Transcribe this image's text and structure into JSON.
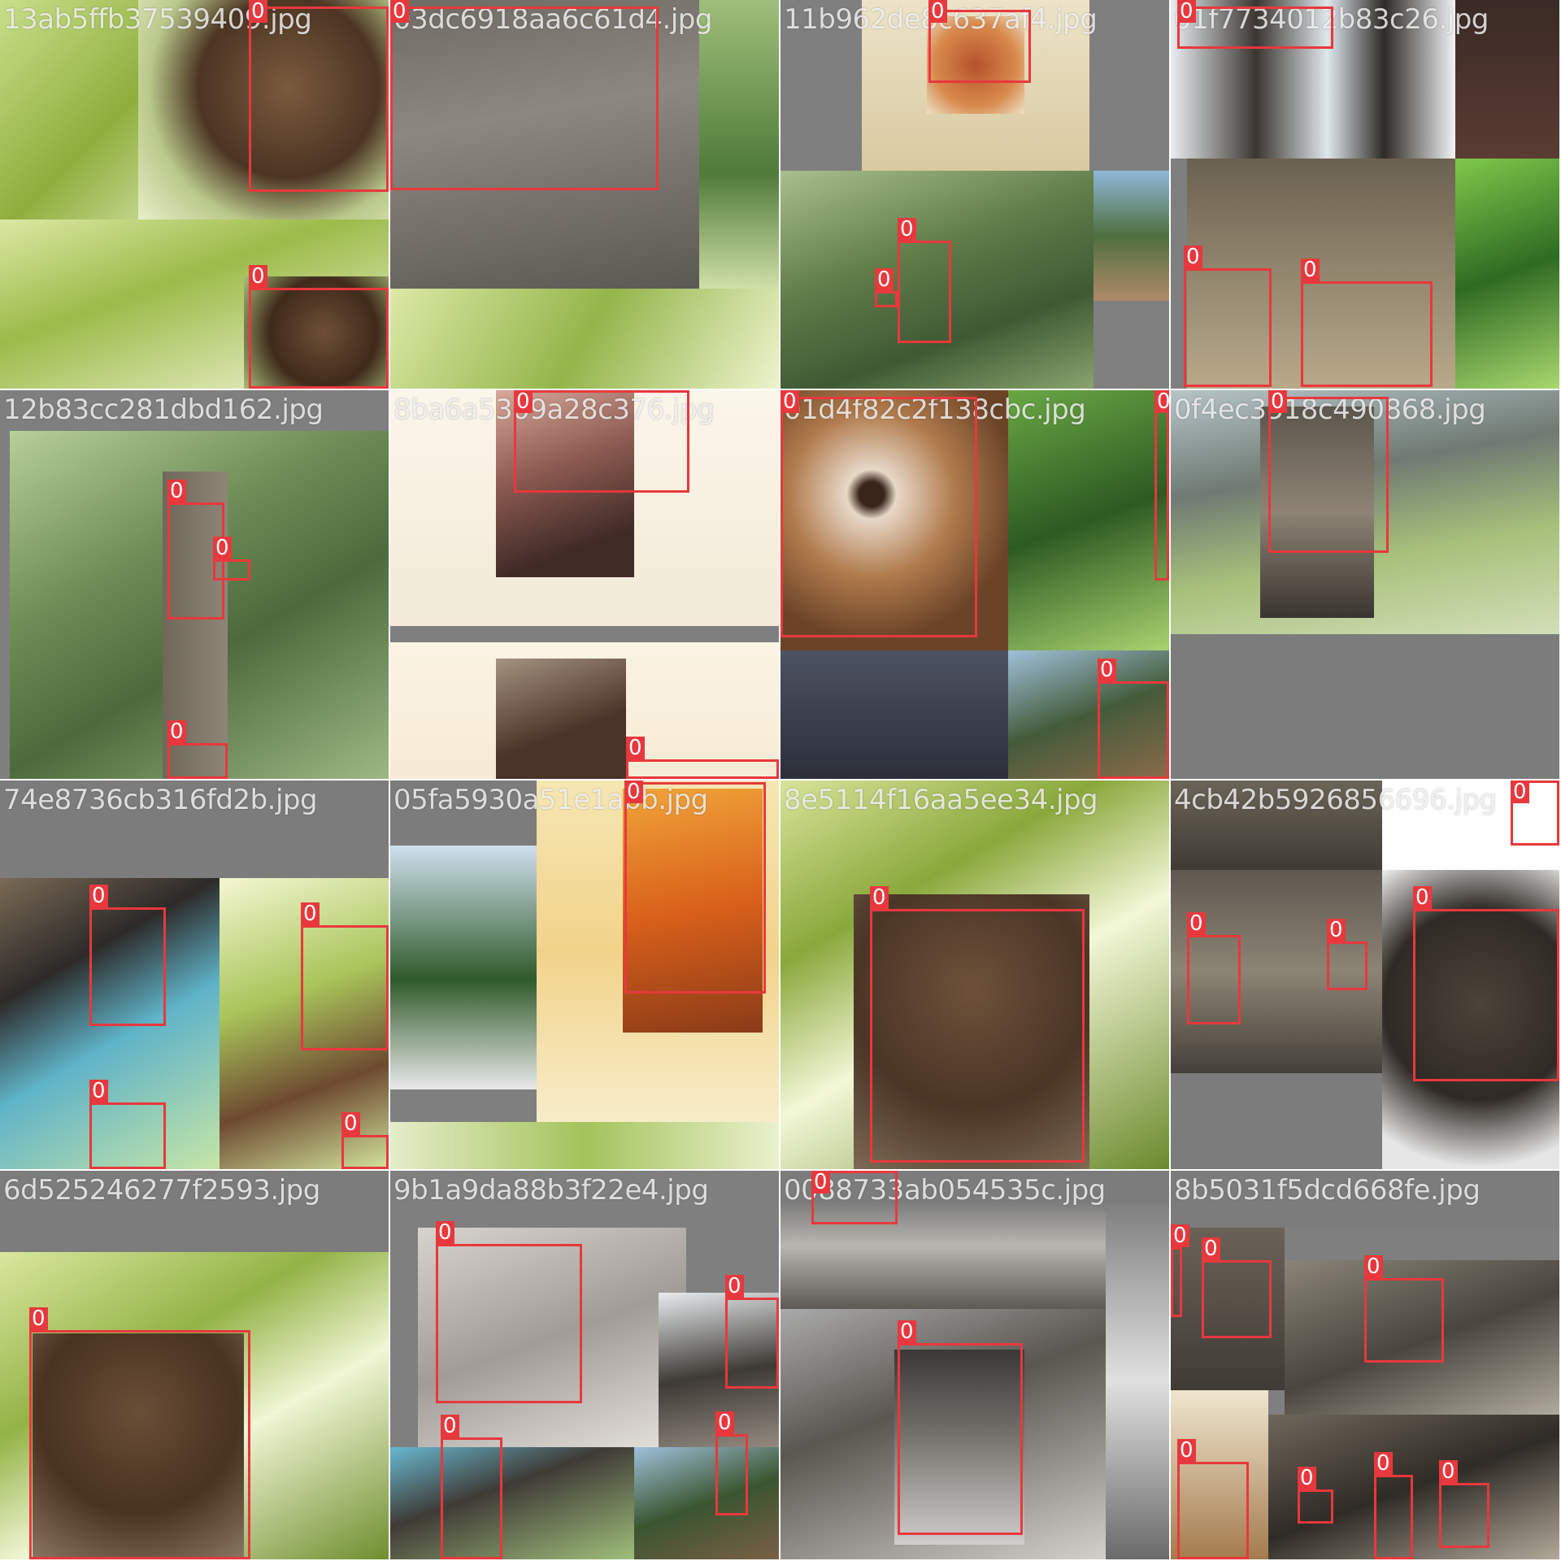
{
  "colors": {
    "box": "#e8383d",
    "label_text": "#ffffff",
    "filename_text": "#eeeeee",
    "pad": "#7f7f7f"
  },
  "box_label": "0",
  "tiles": [
    {
      "filename": "13ab5ffb37539409.jpg"
    },
    {
      "filename": "03dc6918aa6c61d4.jpg"
    },
    {
      "filename": "11b962de8c637af4.jpg"
    },
    {
      "filename": "01f7734012b83c26.jpg"
    },
    {
      "filename": "12b83cc281dbd162.jpg"
    },
    {
      "filename": "8ba6a5309a28c376.jpg"
    },
    {
      "filename": "01d4f82c2f138cbc.jpg"
    },
    {
      "filename": "0f4ec3518c490868.jpg"
    },
    {
      "filename": "74e8736cb316fd2b.jpg"
    },
    {
      "filename": "05fa5930a51e1abb.jpg"
    },
    {
      "filename": "8e5114f16aa5ee34.jpg"
    },
    {
      "filename": "4cb42b5926856696.jpg"
    },
    {
      "filename": "6d525246277f2593.jpg"
    },
    {
      "filename": "9b1a9da88b3f22e4.jpg"
    },
    {
      "filename": "0088733ab054535c.jpg"
    },
    {
      "filename": "8b5031f5dcd668fe.jpg"
    }
  ]
}
